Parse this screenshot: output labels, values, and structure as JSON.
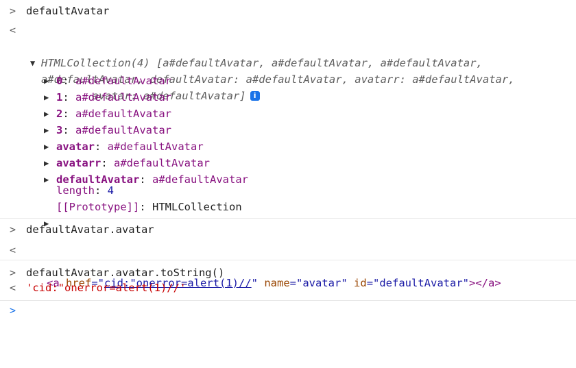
{
  "entries": [
    {
      "input": "defaultAvatar"
    }
  ],
  "collection": {
    "summary_line1": "HTMLCollection(4) [a#defaultAvatar, a#defaultAvatar, a#defaultAvatar,",
    "summary_line2": "a#defaultAvatar, defaultAvatar: a#defaultAvatar, avatarr: a#defaultAvatar,",
    "summary_line3": "avatar: a#defaultAvatar]",
    "info_icon": "i",
    "items": [
      {
        "key": "0",
        "value": "a#defaultAvatar"
      },
      {
        "key": "1",
        "value": "a#defaultAvatar"
      },
      {
        "key": "2",
        "value": "a#defaultAvatar"
      },
      {
        "key": "3",
        "value": "a#defaultAvatar"
      },
      {
        "key": "avatar",
        "value": "a#defaultAvatar"
      },
      {
        "key": "avatarr",
        "value": "a#defaultAvatar"
      },
      {
        "key": "defaultAvatar",
        "value": "a#defaultAvatar"
      }
    ],
    "length_key": "length",
    "length_value": "4",
    "prototype_key": "[[Prototype]]",
    "prototype_value": "HTMLCollection"
  },
  "second": {
    "input": "defaultAvatar.avatar",
    "tag_open": "<a",
    "href_attr": "href",
    "href_quote_open": "=\"",
    "href_value": "cid:\"onerror=alert(1)//",
    "href_quote_close": "\"",
    "name_attr": "name",
    "name_value": "=\"avatar\"",
    "id_attr": "id",
    "id_value": "=\"defaultAvatar\"",
    "tag_close": "></a>"
  },
  "third": {
    "input": "defaultAvatar.avatar.toString()",
    "output": "'cid:\"onerror=alert(1)//'"
  },
  "icons": {
    "input_prompt": "chevron-right-icon",
    "output_prompt": "chevron-left-icon",
    "active_prompt": "chevron-right-icon"
  },
  "colors": {
    "prop": "#881280",
    "number": "#1a1aa6",
    "string": "#c80000",
    "prompt_active": "#1a73e8"
  }
}
